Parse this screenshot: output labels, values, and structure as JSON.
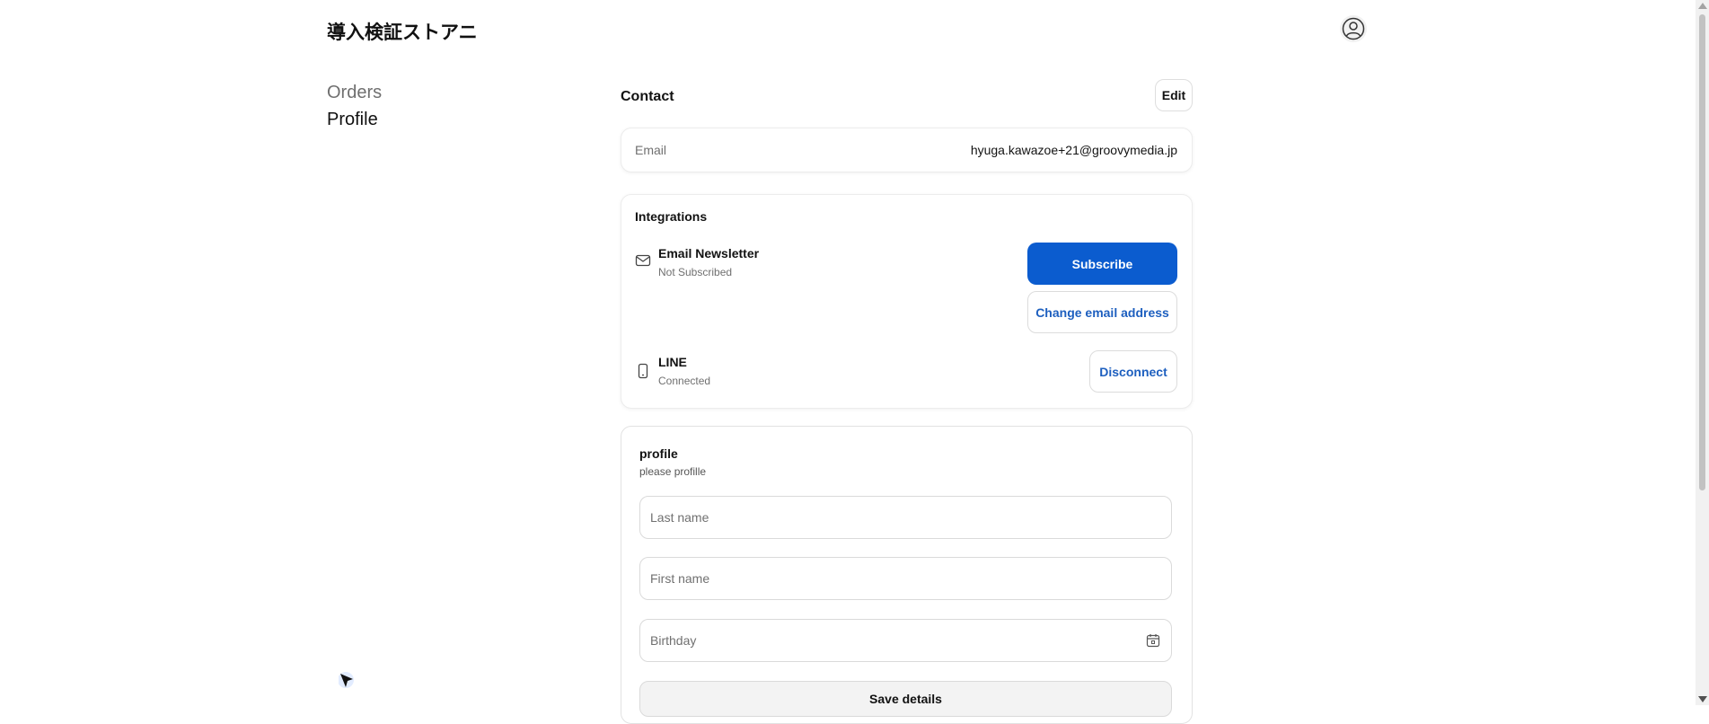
{
  "header": {
    "store_name": "導入検証ストアニ",
    "avatar_icon": "account-icon"
  },
  "nav": {
    "orders": "Orders",
    "profile": "Profile"
  },
  "contact": {
    "title": "Contact",
    "edit_label": "Edit",
    "email_label": "Email",
    "email_value": "hyuga.kawazoe+21@groovymedia.jp"
  },
  "integrations": {
    "title": "Integrations",
    "newsletter": {
      "name": "Email Newsletter",
      "status": "Not Subscribed",
      "icon": "mail-icon",
      "subscribe_label": "Subscribe",
      "change_email_label": "Change email address"
    },
    "line": {
      "name": "LINE",
      "status": "Connected",
      "icon": "phone-icon",
      "disconnect_label": "Disconnect"
    }
  },
  "profile": {
    "title": "profile",
    "subtitle": "please profille",
    "last_name_placeholder": "Last name",
    "first_name_placeholder": "First name",
    "birthday_placeholder": "Birthday",
    "birthday_icon": "calendar-icon",
    "save_label": "Save details"
  },
  "colors": {
    "primary": "#0b5ccf",
    "link": "#1d5fbf",
    "muted": "#707070"
  }
}
